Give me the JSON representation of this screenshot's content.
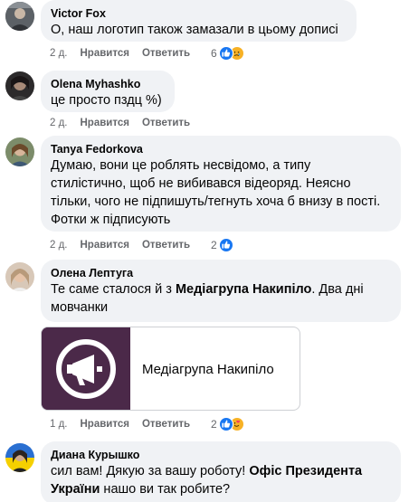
{
  "comments": [
    {
      "author": "Victor Fox",
      "text": "О, наш логотип також замазали в цьому дописі",
      "time": "2 д.",
      "like": "Нравится",
      "reply": "Ответить",
      "reactions": {
        "count": "6",
        "icons": [
          "like-icon",
          "sad-icon"
        ]
      }
    },
    {
      "author": "Olena Myhashko",
      "text": "це просто пздц %)",
      "time": "2 д.",
      "like": "Нравится",
      "reply": "Ответить"
    },
    {
      "author": "Tanya Fedorkova",
      "lines": [
        "Думаю, вони це роблять несвідомо, а типу",
        "стилістично, щоб не вибивався відеоряд. Неясно",
        "тільки, чого не підпишуть/тегнуть хоча б внизу в пості.",
        "Фотки ж підписують"
      ],
      "time": "2 д.",
      "like": "Нравится",
      "reply": "Ответить",
      "reactions": {
        "count": "2",
        "icons": [
          "like-icon"
        ]
      }
    },
    {
      "author": "Олена Лептуга",
      "line1_a": "Те саме сталося й з ",
      "line1_b": "Медіагрупа Накипіло",
      "line1_c": ". Два дні",
      "line2": "мовчанки",
      "link_card_title": "Медіагрупа Накипіло",
      "time": "1 д.",
      "like": "Нравится",
      "reply": "Ответить",
      "reactions": {
        "count": "2",
        "icons": [
          "like-icon",
          "love-icon"
        ]
      }
    },
    {
      "author": "Диана Курышко",
      "line1_a": "сил вам! Дякую за вашу роботу! ",
      "line1_b": "Офіс Президента",
      "line2_a": "України",
      "line2_b": " нашо ви так робите?"
    }
  ],
  "colors": {
    "bubble": "#f0f2f5",
    "meta_text": "#65676b",
    "like_blue": "#1877f2",
    "emoji_yellow": "#f7b125",
    "card_logo_bg": "#4b2949"
  }
}
